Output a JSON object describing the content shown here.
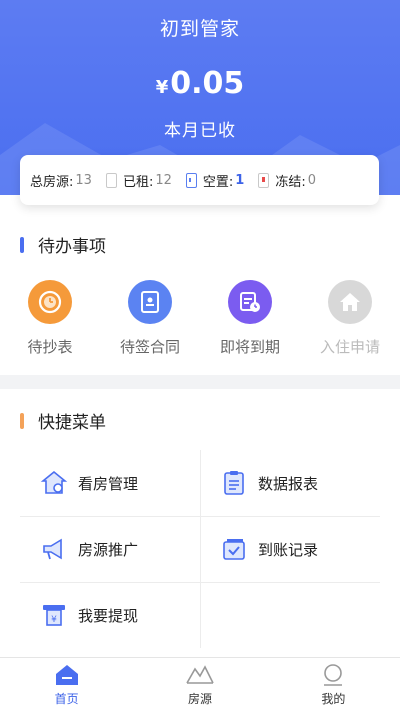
{
  "header": {
    "title": "初到管家",
    "currency": "¥",
    "amount": "0.05",
    "amount_label": "本月已收"
  },
  "stats": [
    {
      "label": "总房源:",
      "value": "13"
    },
    {
      "label": "已租:",
      "value": "12"
    },
    {
      "label": "空置:",
      "value": "1"
    },
    {
      "label": "冻结:",
      "value": "0"
    }
  ],
  "todo": {
    "title": "待办事项",
    "items": [
      {
        "label": "待抄表",
        "icon": "meter-clock-icon"
      },
      {
        "label": "待签合同",
        "icon": "contract-icon"
      },
      {
        "label": "即将到期",
        "icon": "calendar-clock-icon"
      },
      {
        "label": "入住申请",
        "icon": "house-icon"
      }
    ]
  },
  "menu": {
    "title": "快捷菜单",
    "items": [
      {
        "label": "看房管理",
        "icon": "house-gear-icon"
      },
      {
        "label": "数据报表",
        "icon": "clipboard-icon"
      },
      {
        "label": "房源推广",
        "icon": "megaphone-icon"
      },
      {
        "label": "到账记录",
        "icon": "checked-card-icon"
      },
      {
        "label": "我要提现",
        "icon": "withdraw-icon"
      }
    ]
  },
  "tabbar": [
    {
      "label": "首页",
      "icon": "home-tab-icon"
    },
    {
      "label": "房源",
      "icon": "building-tab-icon"
    },
    {
      "label": "我的",
      "icon": "profile-tab-icon"
    }
  ],
  "colors": {
    "primary": "#4a6ef0",
    "accent_orange": "#f4a259",
    "todo_orange": "#f59a3a",
    "todo_blue": "#5b83f2",
    "todo_purple": "#7b5cf0",
    "disabled": "#d8d8d8"
  }
}
